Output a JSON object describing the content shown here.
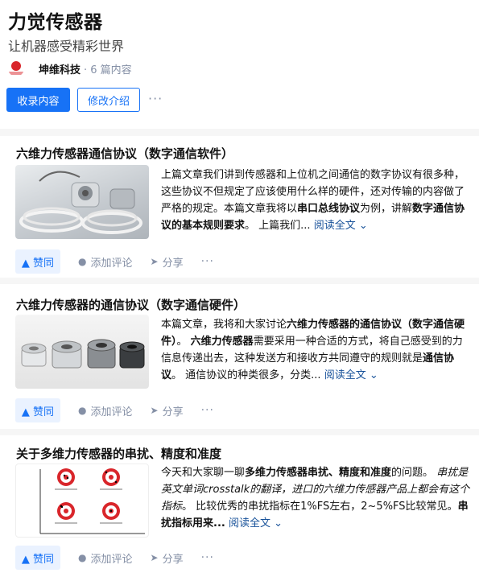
{
  "column": {
    "title": "力觉传感器",
    "description": "让机器感受精彩世界",
    "author_name": "坤维科技",
    "author_meta": "· 6 篇内容",
    "primary_button": "收录内容",
    "secondary_button": "修改介绍",
    "more": "···"
  },
  "actions": {
    "vote": "▲ 赞同",
    "comment": "添加评论",
    "share": "分享",
    "more": "···"
  },
  "articles": [
    {
      "title": "六维力传感器通信协议（数字通信软件）",
      "excerpt_1": "上篇文章我们讲到传感器和上位机之间通信的数字协议有很多种，这些协议不但规定了应该使用什么样的硬件，还对传输的内容做了严格的规定。本篇文章我将以",
      "bold_1": "串口总线协议",
      "excerpt_2": "为例，讲解",
      "bold_2": "数字通信协议的基本规则要求",
      "excerpt_3": "。 上篇我们...",
      "read_more": "阅读全文 ⌄"
    },
    {
      "title": "六维力传感器的通信协议（数字通信硬件）",
      "excerpt_1": "本篇文章，我将和大家讨论",
      "bold_1": "六维力传感器的通信协议（数字通信硬件）",
      "excerpt_2": "。",
      "bold_2": "六维力传感器",
      "excerpt_3": "需要采用一种合适的方式，将自己感受到的力信息传递出去，这种发送方和接收方共同遵守的规则就是",
      "bold_3": "通信协议",
      "excerpt_4": "。 通信协议的种类很多，分类...",
      "read_more": "阅读全文 ⌄"
    },
    {
      "title": "关于多维力传感器的串扰、精度和准度",
      "excerpt_1": "今天和大家聊一聊",
      "bold_1": "多维力传感器串扰、精度和准度",
      "excerpt_2": "的问题。",
      "italic_1": "串扰是英文单词crosstalk的翻译，进口的六维力传感器产品上都会有这个指标",
      "excerpt_3": "。 比较优秀的串扰指标在1%FS左右，2~5%FS比较常见。",
      "bold_2": "串扰指标用来...",
      "read_more": "阅读全文 ⌄"
    }
  ],
  "colors": {
    "brand_blue": "#1772f6",
    "vote_bg": "#eaf2ff",
    "link": "#175199",
    "muted": "#8590a6",
    "logo_red": "#d9262b"
  }
}
